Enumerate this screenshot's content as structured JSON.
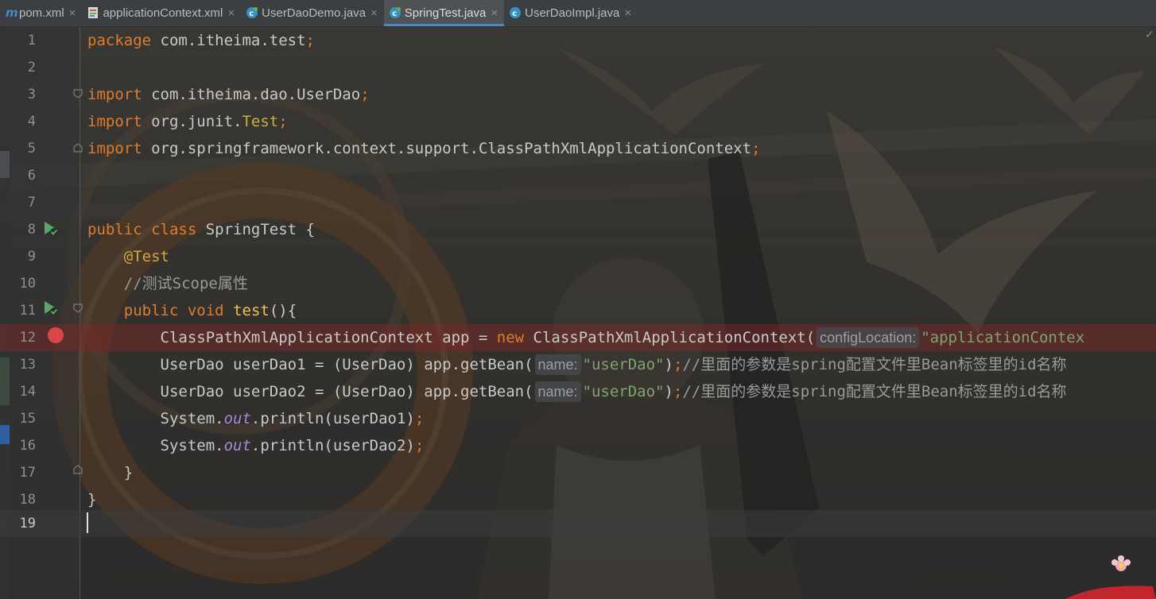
{
  "tabs": [
    {
      "label": "pom.xml",
      "icon": "maven-m-icon",
      "active": false
    },
    {
      "label": "applicationContext.xml",
      "icon": "xml-file-icon",
      "active": false
    },
    {
      "label": "UserDaoDemo.java",
      "icon": "java-class-icon",
      "active": false
    },
    {
      "label": "SpringTest.java",
      "icon": "java-class-icon",
      "active": true
    },
    {
      "label": "UserDaoImpl.java",
      "icon": "java-class-icon",
      "active": false
    }
  ],
  "close_glyph": "×",
  "line_numbers": [
    "1",
    "2",
    "3",
    "4",
    "5",
    "6",
    "7",
    "8",
    "9",
    "10",
    "11",
    "12",
    "13",
    "14",
    "15",
    "16",
    "17",
    "18",
    "19"
  ],
  "code": {
    "l1_kw": "package",
    "l1_rest": " com.itheima.test",
    "semi": ";",
    "l3_kw": "import",
    "l3_rest": " com.itheima.dao.UserDao",
    "l4_kw": "import",
    "l4_rest": " org.junit.",
    "l4_cls": "Test",
    "l5_kw": "import",
    "l5_rest": " org.springframework.context.support.ClassPathXmlApplicationContext",
    "l8_kw": "public class",
    "l8_rest": " SpringTest {",
    "l9_ann": "@Test",
    "l10_cmt": "//测试Scope属性",
    "l11_kw": "public void",
    "l11_fn": "test",
    "l11_rest": "(){",
    "l12_a": "ClassPathXmlApplicationContext app = ",
    "l12_kw": "new",
    "l12_b": " ClassPathXmlApplicationContext(",
    "l12_hint": "configLocation:",
    "l12_str": "\"applicationContex",
    "l13_a": "UserDao userDao1 = (UserDao) app.getBean(",
    "hint_name": "name:",
    "str_userDao": "\"userDao\"",
    "close_paren": ")",
    "comment_bean": "//里面的参数是spring配置文件里Bean标签里的id名称",
    "l14_a": "UserDao userDao2 = (UserDao) app.getBean(",
    "l15_a": "System.",
    "out": "out",
    "l15_b": ".println(userDao1)",
    "l16_b": ".println(userDao2)",
    "l17": "}",
    "l18": "}"
  },
  "status_check": "✓",
  "colors": {
    "keyword": "#e07b2b",
    "string": "#7fa36c",
    "comment": "#9a9a9a",
    "breakpoint": "#d94848",
    "tab_underline": "#4a88c7"
  }
}
